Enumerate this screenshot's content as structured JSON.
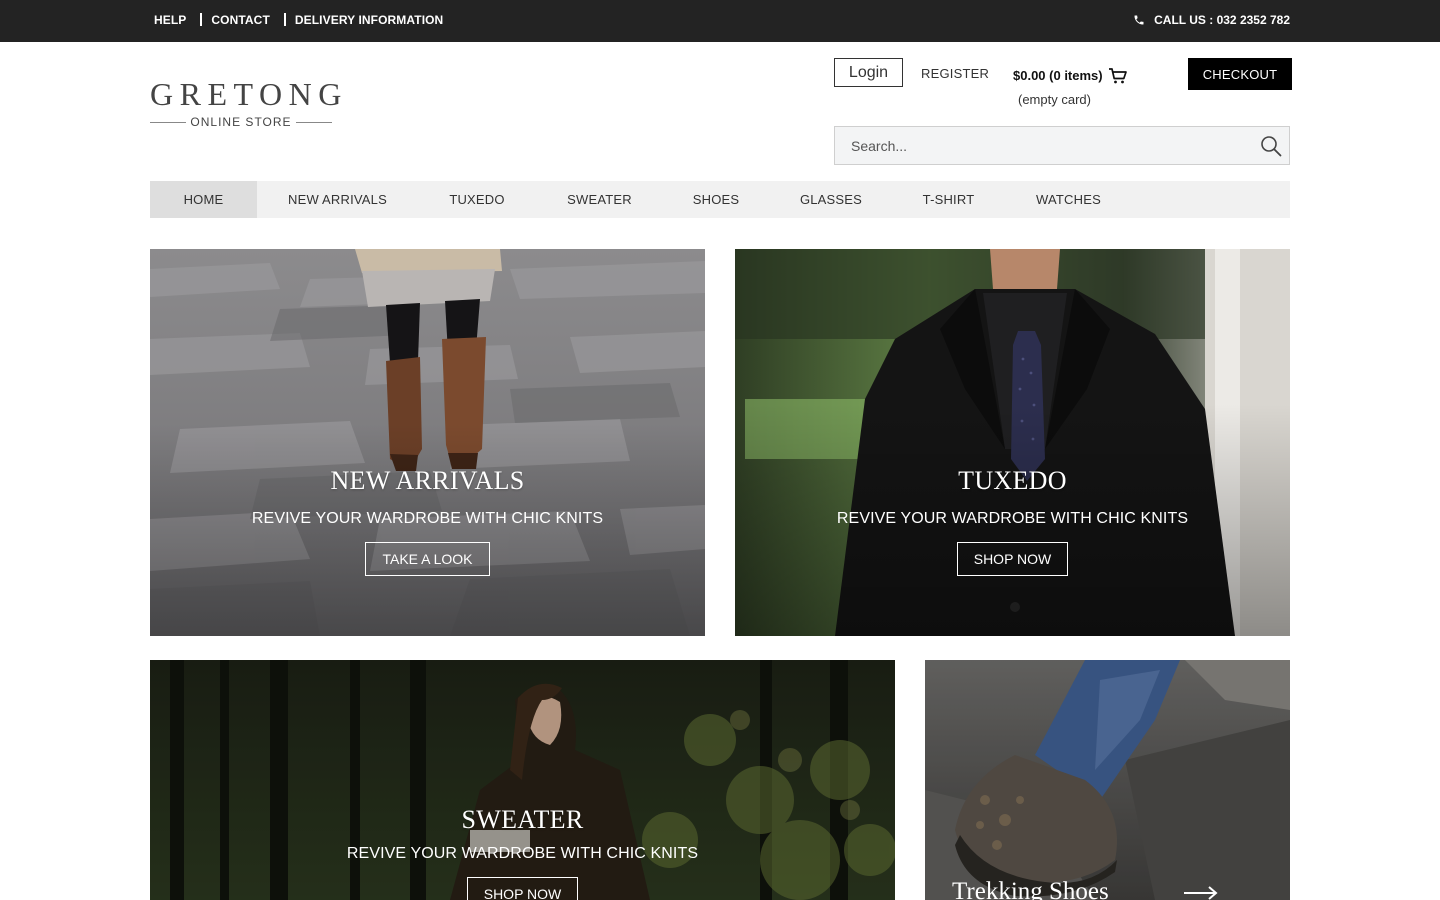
{
  "topbar": {
    "links": [
      "HELP",
      "CONTACT",
      "DELIVERY INFORMATION"
    ],
    "call_us": "CALL US : 032 2352 782"
  },
  "logo": {
    "title": "GRETONG",
    "subtitle": "ONLINE STORE"
  },
  "account": {
    "login_label": "Login",
    "register_label": "REGISTER",
    "cart_summary": "$0.00 (0 items)",
    "cart_status": "(empty card)",
    "checkout_label": "CHECKOUT"
  },
  "search": {
    "placeholder": "Search..."
  },
  "nav": {
    "items": [
      "HOME",
      "NEW ARRIVALS",
      "TUXEDO",
      "SWEATER",
      "SHOES",
      "GLASSES",
      "T-SHIRT",
      "WATCHES"
    ],
    "active": "HOME"
  },
  "banners": [
    {
      "title": "NEW ARRIVALS",
      "subtitle": "REVIVE YOUR WARDROBE WITH CHIC KNITS",
      "button": "TAKE A LOOK"
    },
    {
      "title": "TUXEDO",
      "subtitle": "REVIVE YOUR WARDROBE WITH CHIC KNITS",
      "button": "SHOP NOW"
    },
    {
      "title": "SWEATER",
      "subtitle": "REVIVE YOUR WARDROBE WITH CHIC KNITS",
      "button": "SHOP NOW"
    },
    {
      "title": "Trekking Shoes"
    }
  ],
  "icons": {
    "phone": "phone-icon",
    "cart": "cart-icon",
    "search": "search-icon",
    "arrow": "arrow-right-icon"
  },
  "colors": {
    "topbar_bg": "#232323",
    "checkout_bg": "#000000",
    "nav_bg": "#f1f1f1",
    "nav_active_bg": "#dedede"
  }
}
